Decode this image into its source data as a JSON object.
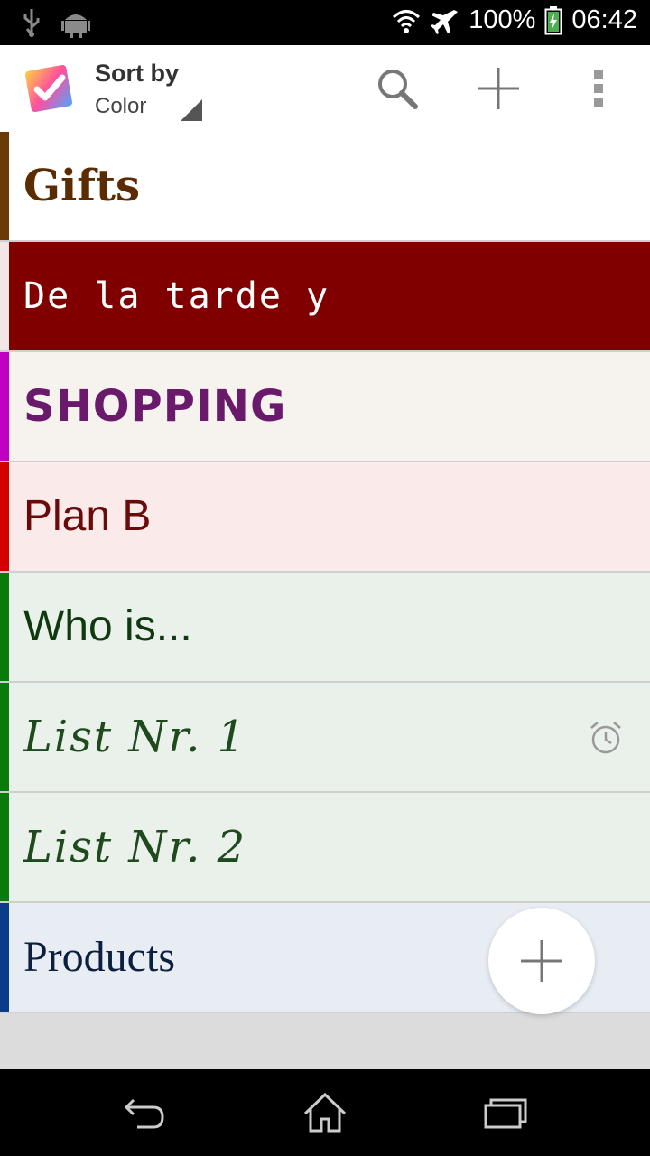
{
  "status_bar": {
    "battery": "100%",
    "time": "06:42"
  },
  "app_bar": {
    "sort_label": "Sort by",
    "sort_value": "Color",
    "icons": [
      "app-logo-icon",
      "search-icon",
      "add-icon",
      "overflow-menu-icon"
    ]
  },
  "lists": [
    {
      "title": "Gifts",
      "text_color": "#5a2c00",
      "stripe_color": "#6b3a08",
      "bg": "#ffffff",
      "font": "serif-bold"
    },
    {
      "title": "De la tarde y",
      "text_color": "#ffffff",
      "stripe_color": "#f2e6e6",
      "bg": "#800000",
      "font": "mono"
    },
    {
      "title": "SHOPPING",
      "text_color": "#6a1a6a",
      "stripe_color": "#c000c0",
      "bg": "#f6f2ee",
      "font": "heavy"
    },
    {
      "title": "Plan B",
      "text_color": "#6b0a0a",
      "stripe_color": "#d40000",
      "bg": "#fbeaea",
      "font": "sans"
    },
    {
      "title": "Who is...",
      "text_color": "#0f3a0f",
      "stripe_color": "#0a7a0a",
      "bg": "#eaf1ea",
      "font": "sans"
    },
    {
      "title": "List  Nr. 1",
      "text_color": "#1e4a1e",
      "stripe_color": "#0a7a0a",
      "bg": "#eaf1ea",
      "font": "script",
      "has_alarm": true
    },
    {
      "title": "List  Nr. 2",
      "text_color": "#1e4a1e",
      "stripe_color": "#0a7a0a",
      "bg": "#eaf1ea",
      "font": "script"
    },
    {
      "title": "Products",
      "text_color": "#0d1f3f",
      "stripe_color": "#0a3c8a",
      "bg": "#e8edf4",
      "font": "serif"
    }
  ],
  "fab": {
    "icon": "add-icon"
  },
  "nav_bar": {
    "icons": [
      "back-icon",
      "home-icon",
      "recents-icon"
    ]
  }
}
